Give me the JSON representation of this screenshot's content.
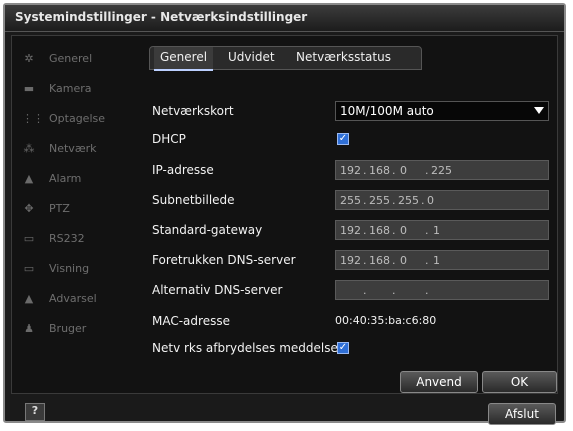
{
  "window": {
    "title": "Systemindstillinger - Netværksindstillinger"
  },
  "sidebar": {
    "items": [
      {
        "label": "Generel",
        "icon": "gear-icon"
      },
      {
        "label": "Kamera",
        "icon": "camera-icon"
      },
      {
        "label": "Optagelse",
        "icon": "record-icon"
      },
      {
        "label": "Netværk",
        "icon": "network-icon"
      },
      {
        "label": "Alarm",
        "icon": "alarm-icon"
      },
      {
        "label": "PTZ",
        "icon": "ptz-icon"
      },
      {
        "label": "RS232",
        "icon": "serial-port-icon"
      },
      {
        "label": "Visning",
        "icon": "monitor-icon"
      },
      {
        "label": "Advarsel",
        "icon": "warning-icon"
      },
      {
        "label": "Bruger",
        "icon": "user-icon"
      }
    ]
  },
  "tabs": [
    {
      "label": "Generel",
      "active": true
    },
    {
      "label": "Udvidet",
      "active": false
    },
    {
      "label": "Netværksstatus",
      "active": false
    }
  ],
  "form": {
    "nic_label": "Netværkskort",
    "nic_value": "10M/100M auto",
    "dhcp_label": "DHCP",
    "dhcp_checked": true,
    "ip_label": "IP-adresse",
    "ip": [
      "192",
      "168",
      "0",
      "225"
    ],
    "mask_label": "Subnetbillede",
    "mask": [
      "255",
      "255",
      "255",
      "0"
    ],
    "gateway_label": "Standard-gateway",
    "gateway": [
      "192",
      "168",
      "0",
      "1"
    ],
    "dns1_label": "Foretrukken DNS-server",
    "dns1": [
      "192",
      "168",
      "0",
      "1"
    ],
    "dns2_label": "Alternativ DNS-server",
    "dns2": [
      "",
      "",
      "",
      ""
    ],
    "mac_label": "MAC-adresse",
    "mac_value": "00:40:35:ba:c6:80",
    "disconnect_label": "Netv rks afbrydelses meddelse",
    "disconnect_checked": true
  },
  "buttons": {
    "apply": "Anvend",
    "ok": "OK",
    "exit": "Afslut",
    "help": "?"
  },
  "colors": {
    "background": "#121212",
    "checkbox": "#2f6fd6",
    "text": "#f2f2f2"
  }
}
